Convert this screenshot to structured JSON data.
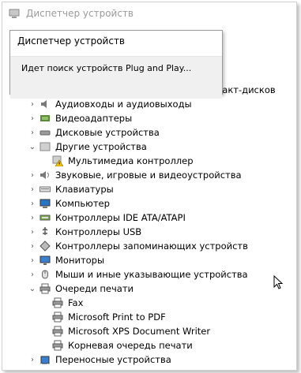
{
  "window": {
    "title": "Диспетчер устройств"
  },
  "popup": {
    "title": "Диспетчер устройств",
    "message": "Идет поиск устройств Plug and Play..."
  },
  "tree": {
    "partial_item": "DVD-дисководы и дисководы компакт-дисков",
    "items": [
      {
        "label": "Аудиовходы и аудиовыходы",
        "icon": "speaker-icon",
        "expanded": false
      },
      {
        "label": "Видеоадаптеры",
        "icon": "display-adapter-icon",
        "expanded": false
      },
      {
        "label": "Дисковые устройства",
        "icon": "disk-drive-icon",
        "expanded": false
      },
      {
        "label": "Другие устройства",
        "icon": "unknown-device-icon",
        "expanded": true
      },
      {
        "label": "Мультимедиа контроллер",
        "icon": "warning-device-icon",
        "child": true
      },
      {
        "label": "Звуковые, игровые и видеоустройства",
        "icon": "sound-icon",
        "expanded": false
      },
      {
        "label": "Клавиатуры",
        "icon": "keyboard-icon",
        "expanded": false
      },
      {
        "label": "Компьютер",
        "icon": "computer-icon",
        "expanded": false
      },
      {
        "label": "Контроллеры IDE ATA/ATAPI",
        "icon": "ide-controller-icon",
        "expanded": false
      },
      {
        "label": "Контроллеры USB",
        "icon": "usb-icon",
        "expanded": false
      },
      {
        "label": "Контроллеры запоминающих устройств",
        "icon": "storage-controller-icon",
        "expanded": false
      },
      {
        "label": "Мониторы",
        "icon": "monitor-icon",
        "expanded": false
      },
      {
        "label": "Мыши и иные указывающие устройства",
        "icon": "mouse-icon",
        "expanded": false
      },
      {
        "label": "Очереди печати",
        "icon": "printer-icon",
        "expanded": true
      },
      {
        "label": "Fax",
        "icon": "printer-icon",
        "child": true
      },
      {
        "label": "Microsoft Print to PDF",
        "icon": "printer-icon",
        "child": true
      },
      {
        "label": "Microsoft XPS Document Writer",
        "icon": "printer-icon",
        "child": true
      },
      {
        "label": "Корневая очередь печати",
        "icon": "printer-icon",
        "child": true
      },
      {
        "label": "Переносные устройства",
        "icon": "portable-device-icon",
        "expanded": false
      }
    ]
  }
}
